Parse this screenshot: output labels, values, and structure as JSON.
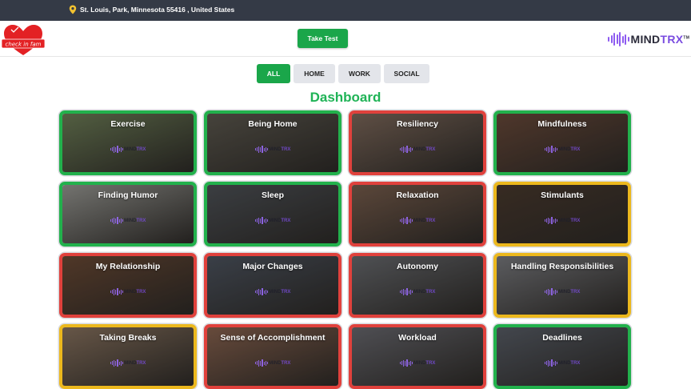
{
  "location": {
    "text": "St. Louis, Park, Minnesota 55416 , United States",
    "icon": "map-pin-icon",
    "icon_color": "#f2c230"
  },
  "header": {
    "logo_left_text": "check in fam",
    "take_test_label": "Take Test",
    "logo_right": {
      "brand_a": "MIND",
      "brand_b": "TRX",
      "tm": "TM"
    }
  },
  "filters": [
    {
      "label": "ALL",
      "active": true
    },
    {
      "label": "HOME",
      "active": false
    },
    {
      "label": "WORK",
      "active": false
    },
    {
      "label": "SOCIAL",
      "active": false
    }
  ],
  "title": "Dashboard",
  "colors": {
    "green": "#22b14c",
    "red": "#e0413c",
    "yellow": "#ecb81d",
    "accent": "#1aa64a",
    "topbar": "#343a46"
  },
  "cards": [
    {
      "label": "Exercise",
      "status": "green",
      "bg": "#6f7f58"
    },
    {
      "label": "Being Home",
      "status": "green",
      "bg": "#5e5a50"
    },
    {
      "label": "Resiliency",
      "status": "red",
      "bg": "#7f6a5c"
    },
    {
      "label": "Mindfulness",
      "status": "green",
      "bg": "#6a4a3a"
    },
    {
      "label": "Finding Humor",
      "status": "green",
      "bg": "#9a9a95"
    },
    {
      "label": "Sleep",
      "status": "green",
      "bg": "#4f5358"
    },
    {
      "label": "Relaxation",
      "status": "red",
      "bg": "#7a5f4e"
    },
    {
      "label": "Stimulants",
      "status": "yellow",
      "bg": "#4a3a2e"
    },
    {
      "label": "My Relationship",
      "status": "red",
      "bg": "#6b4a35"
    },
    {
      "label": "Major Changes",
      "status": "red",
      "bg": "#4e5560"
    },
    {
      "label": "Autonomy",
      "status": "red",
      "bg": "#6a6c70"
    },
    {
      "label": "Handling Responsibilities",
      "status": "yellow",
      "bg": "#7b7c80"
    },
    {
      "label": "Taking Breaks",
      "status": "yellow",
      "bg": "#8a7460"
    },
    {
      "label": "Sense of Accomplishment",
      "status": "red",
      "bg": "#8a6450"
    },
    {
      "label": "Workload",
      "status": "red",
      "bg": "#6a6a70"
    },
    {
      "label": "Deadlines",
      "status": "green",
      "bg": "#5a5f68"
    }
  ],
  "watermark": {
    "a": "MIND",
    "b": "TRX"
  }
}
